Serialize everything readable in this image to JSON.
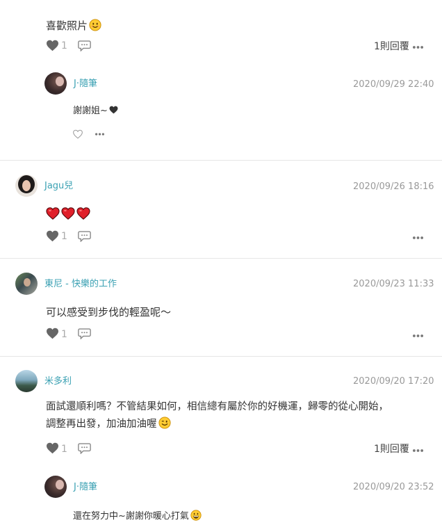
{
  "comments": [
    {
      "text": "喜歡照片",
      "likes": "1",
      "reply_count": "1則回覆",
      "replies": [
        {
          "author": "J·隨筆",
          "time": "2020/09/29 22:40",
          "text": "謝謝姐~"
        }
      ]
    },
    {
      "author": "Jagu兒",
      "time": "2020/09/26 18:16",
      "likes": "1"
    },
    {
      "author": "東尼 - 快樂的工作",
      "time": "2020/09/23 11:33",
      "text": "可以感受到步伐的輕盈呢～",
      "likes": "1"
    },
    {
      "author": "米多利",
      "time": "2020/09/20 17:20",
      "text_line1": "面試還順利嗎？不管結果如何，相信總有屬於你的好機運，歸零的從心開始，",
      "text_line2": "調整再出發，加油加油喔",
      "likes": "1",
      "reply_count": "1則回覆",
      "replies": [
        {
          "author": "J·隨筆",
          "time": "2020/09/20 23:52",
          "text": "還在努力中~謝謝你暖心打氣"
        }
      ]
    }
  ],
  "icons": {
    "like": "heart-icon",
    "comment": "speech-bubble-icon",
    "more": "more-dots-icon",
    "emoji_smile": "smiling-face-icon",
    "emoji_wink": "winking-face-icon",
    "emoji_grin": "grinning-face-icon",
    "black_heart": "black-heart-icon",
    "red_heart": "red-heart-icon"
  },
  "colors": {
    "author_link": "#3ba1b3",
    "timestamp": "#999999",
    "heart_filled": "#666666",
    "red_heart": "#e0202a",
    "divider": "#e6e6e6"
  }
}
